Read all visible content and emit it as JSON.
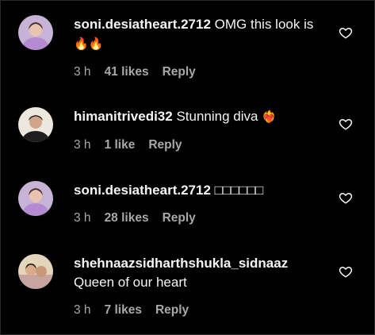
{
  "comments": [
    {
      "username": "soni.desiatheart.2712",
      "text": "OMG this look is",
      "emoji": "🔥🔥",
      "time": "3 h",
      "likes": "41 likes",
      "reply": "Reply",
      "avatar_color": "#b89dc9"
    },
    {
      "username": "himanitrivedi32",
      "text": "Stunning diva",
      "emoji": "❤️‍🔥",
      "time": "3 h",
      "likes": "1 like",
      "reply": "Reply",
      "avatar_color": "#e8e4dc"
    },
    {
      "username": "soni.desiatheart.2712",
      "text": "□□□□□□",
      "emoji": "",
      "time": "3 h",
      "likes": "28 likes",
      "reply": "Reply",
      "avatar_color": "#b89dc9"
    },
    {
      "username": "shehnaazsidharthshukla_sidnaaz",
      "text": "Queen of our heart",
      "emoji": "",
      "time": "3 h",
      "likes": "7 likes",
      "reply": "Reply",
      "avatar_color": "#d8c6a4"
    }
  ],
  "colors": {
    "background": "#000000",
    "text": "#f5f5f5",
    "meta": "#a8a8a8"
  }
}
